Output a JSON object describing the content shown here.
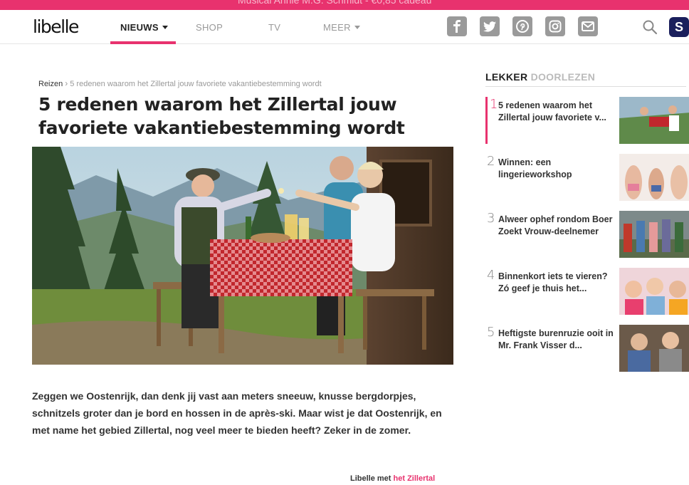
{
  "promo": {
    "text": "Musical Annie M.G. Schmidt - €0,85 cadeau"
  },
  "header": {
    "logo": "libelle",
    "nav": [
      {
        "label": "NIEUWS",
        "active": true,
        "has_caret": true
      },
      {
        "label": "SHOP",
        "active": false
      },
      {
        "label": "TV",
        "active": false
      },
      {
        "label": "MEER",
        "active": false,
        "has_caret": true
      }
    ],
    "social_icons": [
      "facebook-icon",
      "twitter-icon",
      "pinterest-icon",
      "instagram-icon",
      "mail-icon"
    ],
    "search_icon": "search-icon",
    "account_label": "S"
  },
  "article": {
    "breadcrumb_root": "Reizen",
    "breadcrumb_current": "5 redenen waarom het Zillertal jouw favoriete vakantiebestemming wordt",
    "title": "5 redenen waarom het Zillertal jouw favoriete vakantiebestemming wordt",
    "intro": "Zeggen we Oostenrijk, dan denk jij vast aan meters sneeuw, knusse bergdorpjes, schnitzels groter dan je bord en hossen in de après-ski. Maar wist je dat Oostenrijk, en met name het gebied Zillertal, nog veel meer te bieden heeft? Zeker in de zomer.",
    "credit_prefix": "Libelle met",
    "credit_link": "het Zillertal"
  },
  "sidebar": {
    "heading_bold": "LEKKER",
    "heading_light": "DOORLEZEN",
    "items": [
      {
        "num": "1",
        "text": "5 redenen waarom het Zillertal jouw favoriete v..."
      },
      {
        "num": "2",
        "text": "Winnen: een lingerieworkshop"
      },
      {
        "num": "3",
        "text": "Alweer ophef rondom Boer Zoekt Vrouw-deelnemer"
      },
      {
        "num": "4",
        "text": "Binnenkort iets te vieren? Zó geef je thuis het..."
      },
      {
        "num": "5",
        "text": "Heftigste burenruzie ooit in Mr. Frank Visser d..."
      }
    ]
  },
  "colors": {
    "accent": "#e8326e",
    "brand_dark": "#1a1f5c",
    "icon_gray": "#9a9a9a"
  }
}
